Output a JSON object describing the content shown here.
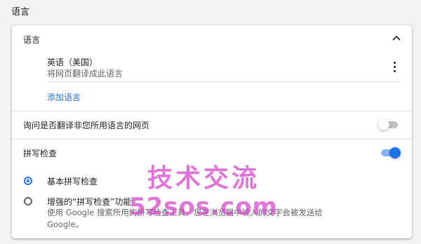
{
  "section": {
    "title": "语言"
  },
  "languages": {
    "header_label": "语言",
    "items": [
      {
        "name": "英语（美国）",
        "description": "将网页翻译成此语言"
      }
    ],
    "add_label": "添加语言"
  },
  "translate_offer": {
    "label": "询问是否翻译非您所用语言的网页",
    "enabled": false
  },
  "spell_check": {
    "label": "拼写检查",
    "enabled": true,
    "options": [
      {
        "label": "基本拼写检查",
        "selected": true
      },
      {
        "label": "增强的“拼写检查”功能",
        "description": "使用 Google 搜索所用的拼写检查工具。您在浏览器中输入的文字会被发送给 Google。",
        "selected": false
      }
    ]
  },
  "watermark": {
    "line1": "技术交流",
    "line2": "52sos.com"
  },
  "colors": {
    "accent": "#1a73e8",
    "page_bg": "#f1f3f4"
  }
}
